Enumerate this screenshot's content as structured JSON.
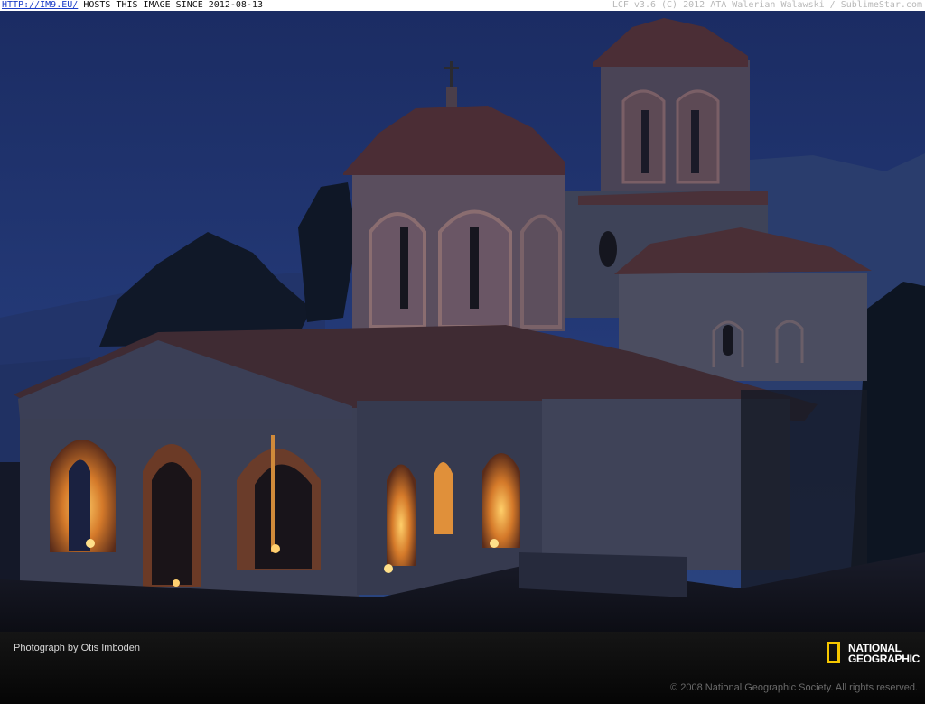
{
  "header": {
    "link_text": "HTTP://IM9.EU/",
    "host_text": " HOSTS THIS IMAGE SINCE 2012-08-13",
    "right_text": "LCF v3.6 (C) 2012 ATA Walerian Walawski / SublimeStar.com"
  },
  "footer": {
    "credit": "Photograph by Otis Imboden",
    "logo_line1": "NATIONAL",
    "logo_line2": "GEOGRAPHIC",
    "copyright": "© 2008 National Geographic Society. All rights reserved."
  },
  "colors": {
    "sky": "#1e3166",
    "stone": "#3a3d55",
    "roof": "#4a3036",
    "candle": "#ffb23a",
    "logo_yellow": "#f6c700"
  }
}
